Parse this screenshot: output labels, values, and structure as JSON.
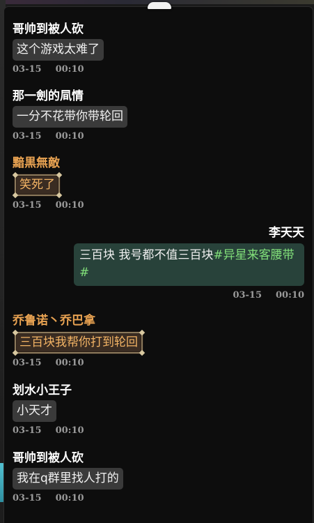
{
  "messages": [
    {
      "sender": "哥帅到被人砍",
      "text": "这个游戏太难了",
      "date": "03-15",
      "time": "00:10"
    },
    {
      "sender": "那一劍的凬情",
      "text": "一分不花带你带轮回",
      "date": "03-15",
      "time": "00:10"
    },
    {
      "sender": "黯黒無敵",
      "text": "笑死了",
      "date": "03-15",
      "time": "00:10",
      "style": "vip"
    },
    {
      "sender": "李天天",
      "text": "三百块 我号都不值三百块",
      "hashtag_a": "#异星来客",
      "hashtag_b": "腰带#",
      "date": "03-15",
      "time": "00:10",
      "style": "self"
    },
    {
      "sender": "乔鲁诺丶乔巴拿",
      "text": "三百块我帮你打到轮回",
      "date": "03-15",
      "time": "00:10",
      "style": "vip"
    },
    {
      "sender": "划水小王子",
      "text": "小天才",
      "date": "03-15",
      "time": "00:10"
    },
    {
      "sender": "哥帅到被人砍",
      "text": "我在q群里找人打的",
      "date": "03-15",
      "time": "00:10"
    }
  ]
}
